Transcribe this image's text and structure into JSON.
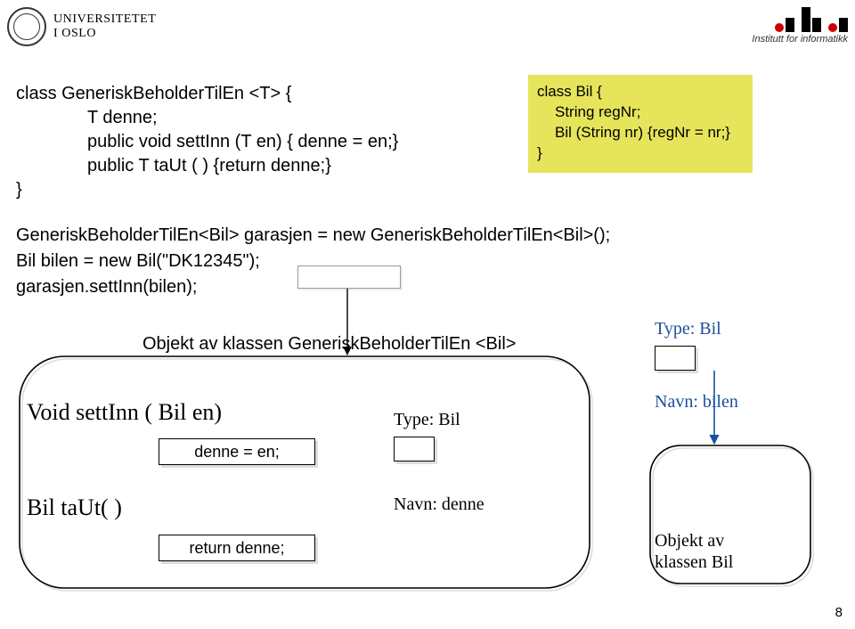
{
  "header": {
    "uio_line1": "UNIVERSITETET",
    "uio_line2": "I OSLO",
    "ifi_label": "Institutt for informatikk"
  },
  "code_left": {
    "l1": "class GeneriskBeholderTilEn <T> {",
    "l2": "T   denne;",
    "l3": "public void settInn (T  en) { denne = en;}",
    "l4": "public T  taUt ( ) {return denne;}",
    "l5": "}"
  },
  "code_right": {
    "l1": "class Bil {",
    "l2": "String regNr;",
    "l3": "Bil (String nr) {regNr = nr;}",
    "l4": "}"
  },
  "mid": {
    "l1": "GeneriskBeholderTilEn<Bil> garasjen = new GeneriskBeholderTilEn<Bil>();",
    "l2": "Bil bilen = new Bil(\"DK12345\");",
    "l3": "garasjen.settInn(bilen);"
  },
  "diagram": {
    "obj_caption": "Objekt av klassen   GeneriskBeholderTilEn <Bil>",
    "void_line": "Void settInn ( Bil   en)",
    "denne_assign": "denne = en;",
    "bil_line": "Bil   taUt( )",
    "return_denne": "return denne;",
    "type_bil": "Type:  Bil",
    "navn_denne": "Navn:  denne",
    "navn_bilen": "Navn:  bilen",
    "objekt_bil_l1": "Objekt av",
    "objekt_bil_l2": "klassen Bil"
  },
  "page": "8"
}
